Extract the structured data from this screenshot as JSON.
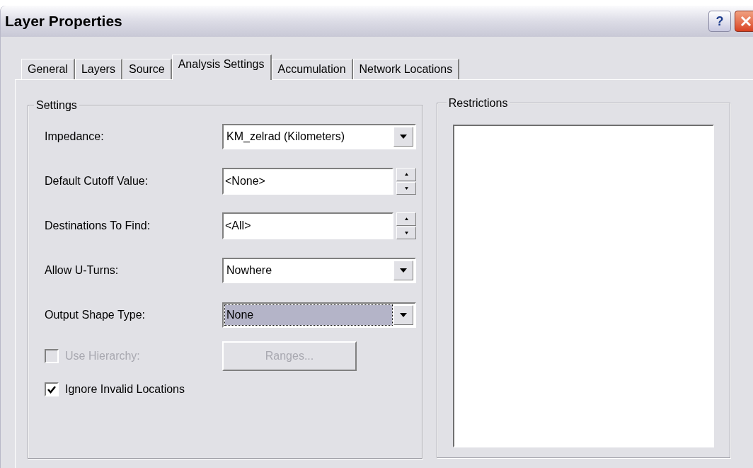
{
  "window": {
    "title": "Layer Properties",
    "buttons": [
      {
        "kind": "help",
        "label": "?"
      },
      {
        "kind": "close"
      }
    ]
  },
  "tabs": [
    {
      "label": "General",
      "selected": false
    },
    {
      "label": "Layers",
      "selected": false
    },
    {
      "label": "Source",
      "selected": false
    },
    {
      "label": "Analysis Settings",
      "selected": true
    },
    {
      "label": "Accumulation",
      "selected": false
    },
    {
      "label": "Network Locations",
      "selected": false
    }
  ],
  "settings": {
    "title": "Settings",
    "fields": [
      {
        "label": "Impedance:",
        "kind": "combo",
        "value": "KM_zelrad (Kilometers)",
        "focused": false
      },
      {
        "label": "Default Cutoff Value:",
        "kind": "spin",
        "value": "<None>",
        "focused": false
      },
      {
        "label": "Destinations To Find:",
        "kind": "spin",
        "value": "<All>",
        "focused": false
      },
      {
        "label": "Allow U-Turns:",
        "kind": "combo",
        "value": "Nowhere",
        "focused": false
      },
      {
        "label": "Output Shape Type:",
        "kind": "combo",
        "value": "None",
        "focused": true
      }
    ],
    "hierarchy": {
      "label": "Use Hierarchy:",
      "checked": false,
      "disabled": true
    },
    "ranges_button": {
      "label": "Ranges...",
      "disabled": true
    },
    "ignore_invalid": {
      "label": "Ignore Invalid Locations",
      "checked": true,
      "disabled": false
    }
  },
  "restrictions": {
    "title": "Restrictions"
  }
}
